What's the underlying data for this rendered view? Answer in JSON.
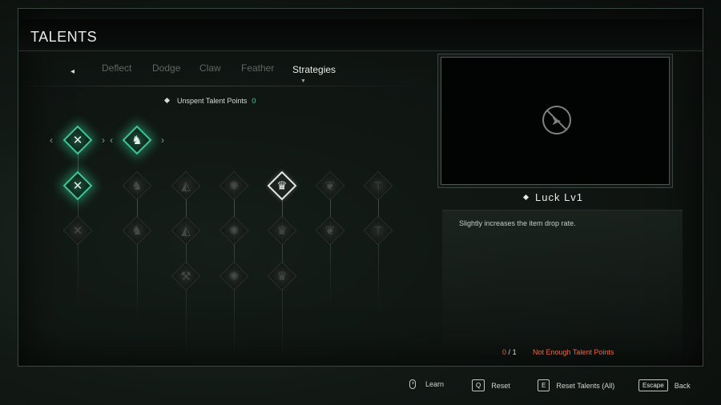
{
  "title": "TALENTS",
  "tabs": {
    "prev_arrow": "◂",
    "items": [
      {
        "label": "Deflect"
      },
      {
        "label": "Dodge"
      },
      {
        "label": "Claw"
      },
      {
        "label": "Feather"
      },
      {
        "label": "Strategies",
        "active": true
      }
    ]
  },
  "unspent": {
    "label": "Unspent Talent Points",
    "value": "0"
  },
  "talent_tree": {
    "learned_count": 3,
    "selected_talent": "Luck Lv1"
  },
  "details": {
    "name": "Luck Lv1",
    "description": "Slightly increases the item drop rate.",
    "points_current": "0",
    "points_sep": "/",
    "points_required": "1",
    "status": "Not Enough Talent Points"
  },
  "footer": {
    "learn": "Learn",
    "reset_key": "Q",
    "reset": "Reset",
    "reset_all_key": "E",
    "reset_all": "Reset Talents (All)",
    "back_key": "Escape",
    "back": "Back"
  },
  "colors": {
    "learned_glow": "#3fc493",
    "warning": "#e06a48",
    "unspent_value": "#4cc79a"
  }
}
